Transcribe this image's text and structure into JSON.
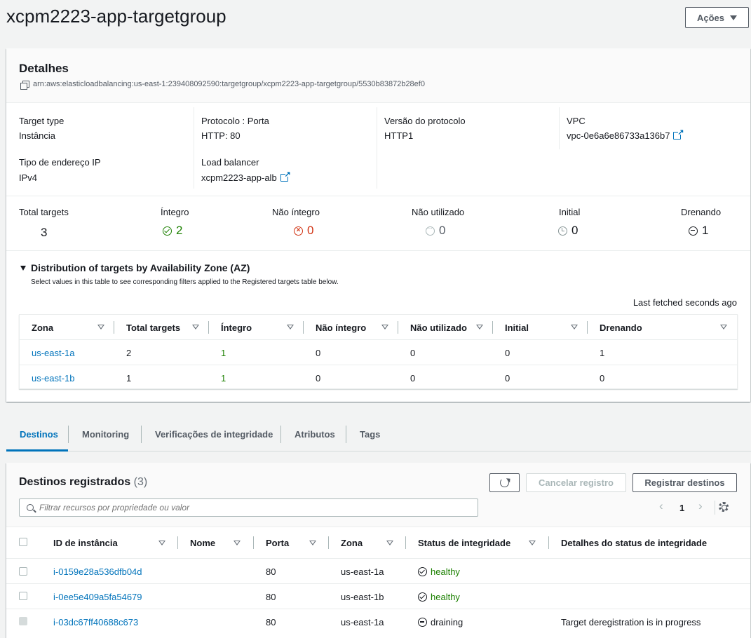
{
  "page": {
    "title": "xcpm2223-app-targetgroup",
    "actions_label": "Ações"
  },
  "details": {
    "heading": "Detalhes",
    "arn": "arn:aws:elasticloadbalancing:us-east-1:239408092590:targetgroup/xcpm2223-app-targetgroup/5530b83872b28ef0",
    "fields": {
      "target_type": {
        "label": "Target type",
        "value": "Instância"
      },
      "protocol_port": {
        "label": "Protocolo : Porta",
        "value": "HTTP: 80"
      },
      "protocol_version": {
        "label": "Versão do protocolo",
        "value": "HTTP1"
      },
      "vpc": {
        "label": "VPC",
        "value": "vpc-0e6a6e86733a136b7"
      },
      "ip_type": {
        "label": "Tipo de endereço IP",
        "value": "IPv4"
      },
      "load_balancer": {
        "label": "Load balancer",
        "value": "xcpm2223-app-alb"
      }
    },
    "counts": {
      "total": {
        "label": "Total targets",
        "value": "3"
      },
      "healthy": {
        "label": "Íntegro",
        "value": "2"
      },
      "unhealthy": {
        "label": "Não íntegro",
        "value": "0"
      },
      "unused": {
        "label": "Não utilizado",
        "value": "0"
      },
      "initial": {
        "label": "Initial",
        "value": "0"
      },
      "draining": {
        "label": "Drenando",
        "value": "1"
      }
    },
    "az": {
      "heading": "Distribution of targets by Availability Zone (AZ)",
      "description": "Select values in this table to see corresponding filters applied to the Registered targets table below.",
      "fetched": "Last fetched seconds ago",
      "columns": [
        "Zona",
        "Total targets",
        "Íntegro",
        "Não íntegro",
        "Não utilizado",
        "Initial",
        "Drenando"
      ],
      "rows": [
        [
          "us-east-1a",
          "2",
          "1",
          "0",
          "0",
          "0",
          "1"
        ],
        [
          "us-east-1b",
          "1",
          "1",
          "0",
          "0",
          "0",
          "0"
        ]
      ]
    }
  },
  "tabs": [
    "Destinos",
    "Monitoring",
    "Verificações de integridade",
    "Atributos",
    "Tags"
  ],
  "targets": {
    "heading": "Destinos registrados",
    "count": "(3)",
    "cancel_label": "Cancelar registro",
    "register_label": "Registrar destinos",
    "search_placeholder": "Filtrar recursos por propriedade ou valor",
    "page_number": "1",
    "columns": [
      "ID de instância",
      "Nome",
      "Porta",
      "Zona",
      "Status de integridade",
      "Detalhes do status de integridade"
    ],
    "rows": [
      [
        "i-0159e28a536dfb04d",
        "",
        "80",
        "us-east-1a",
        "healthy",
        ""
      ],
      [
        "i-0ee5e409a5fa54679",
        "",
        "80",
        "us-east-1b",
        "healthy",
        ""
      ],
      [
        "i-03dc67ff40688c673",
        "",
        "80",
        "us-east-1a",
        "draining",
        "Target deregistration is in progress"
      ]
    ]
  },
  "colors": {
    "link": "#0073bb",
    "healthy": "#1d8102",
    "unhealthy": "#d13212"
  }
}
